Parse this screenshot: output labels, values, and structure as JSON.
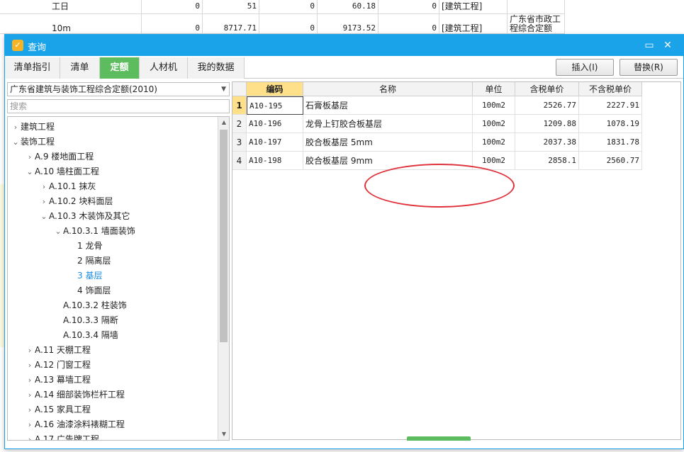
{
  "background_sheet": {
    "rows": [
      {
        "name": "工日",
        "c1": "0",
        "c2": "51",
        "c3": "0",
        "c4": "60.18",
        "c5": "0",
        "type": "[建筑工程]",
        "quota": ""
      },
      {
        "name": "10m",
        "c1": "0",
        "c2": "8717.71",
        "c3": "0",
        "c4": "9173.52",
        "c5": "0",
        "type": "[建筑工程]",
        "quota": "广东省市政工程综合定额"
      }
    ]
  },
  "dialog": {
    "title": "查询",
    "colors": {
      "titlebar": "#1aa3e8",
      "active_tab": "#5cbc5e",
      "annotation": "#e0303a"
    },
    "icons": {
      "app": "query-app-icon",
      "maximize": "maximize-icon",
      "close": "close-icon"
    },
    "tabs": [
      {
        "label": "清单指引",
        "active": false
      },
      {
        "label": "清单",
        "active": false
      },
      {
        "label": "定额",
        "active": true
      },
      {
        "label": "人材机",
        "active": false
      },
      {
        "label": "我的数据",
        "active": false
      }
    ],
    "insert_button": "插入(I)",
    "replace_button": "替换(R)"
  },
  "library_select": {
    "value": "广东省建筑与装饰工程综合定额(2010)"
  },
  "search": {
    "placeholder": "搜索"
  },
  "tree": [
    {
      "label": "建筑工程",
      "level": 0,
      "state": "collapsed"
    },
    {
      "label": "装饰工程",
      "level": 0,
      "state": "expanded"
    },
    {
      "label": "A.9 楼地面工程",
      "level": 1,
      "state": "collapsed"
    },
    {
      "label": "A.10 墙柱面工程",
      "level": 1,
      "state": "expanded"
    },
    {
      "label": "A.10.1 抹灰",
      "level": 2,
      "state": "collapsed"
    },
    {
      "label": "A.10.2 块料面层",
      "level": 2,
      "state": "collapsed"
    },
    {
      "label": "A.10.3 木装饰及其它",
      "level": 2,
      "state": "expanded"
    },
    {
      "label": "A.10.3.1 墙面装饰",
      "level": 3,
      "state": "expanded"
    },
    {
      "label": "1 龙骨",
      "level": 4,
      "state": "leaf"
    },
    {
      "label": "2 隔离层",
      "level": 4,
      "state": "leaf"
    },
    {
      "label": "3 基层",
      "level": 4,
      "state": "leaf",
      "selected": true
    },
    {
      "label": "4 饰面层",
      "level": 4,
      "state": "leaf"
    },
    {
      "label": "A.10.3.2 柱装饰",
      "level": 3,
      "state": "leaf"
    },
    {
      "label": "A.10.3.3 隔断",
      "level": 3,
      "state": "leaf"
    },
    {
      "label": "A.10.3.4 隔墙",
      "level": 3,
      "state": "leaf"
    },
    {
      "label": "A.11 天棚工程",
      "level": 1,
      "state": "collapsed"
    },
    {
      "label": "A.12 门窗工程",
      "level": 1,
      "state": "collapsed"
    },
    {
      "label": "A.13 幕墙工程",
      "level": 1,
      "state": "collapsed"
    },
    {
      "label": "A.14 细部装饰栏杆工程",
      "level": 1,
      "state": "collapsed"
    },
    {
      "label": "A.15 家具工程",
      "level": 1,
      "state": "collapsed"
    },
    {
      "label": "A.16 油漆涂料裱糊工程",
      "level": 1,
      "state": "collapsed"
    },
    {
      "label": "A.17 广告牌工程",
      "level": 1,
      "state": "collapsed"
    }
  ],
  "grid": {
    "columns": [
      "编码",
      "名称",
      "单位",
      "含税单价",
      "不含税单价"
    ],
    "rows": [
      {
        "no": "1",
        "code": "A10-195",
        "name": "石膏板基层",
        "unit": "100m2",
        "price_tax": "2526.77",
        "price_notax": "2227.91"
      },
      {
        "no": "2",
        "code": "A10-196",
        "name": "龙骨上钉胶合板基层",
        "unit": "100m2",
        "price_tax": "1209.88",
        "price_notax": "1078.19"
      },
      {
        "no": "3",
        "code": "A10-197",
        "name": "胶合板基层 5mm",
        "unit": "100m2",
        "price_tax": "2037.38",
        "price_notax": "1831.78"
      },
      {
        "no": "4",
        "code": "A10-198",
        "name": "胶合板基层 9mm",
        "unit": "100m2",
        "price_tax": "2858.1",
        "price_notax": "2560.77"
      }
    ]
  }
}
